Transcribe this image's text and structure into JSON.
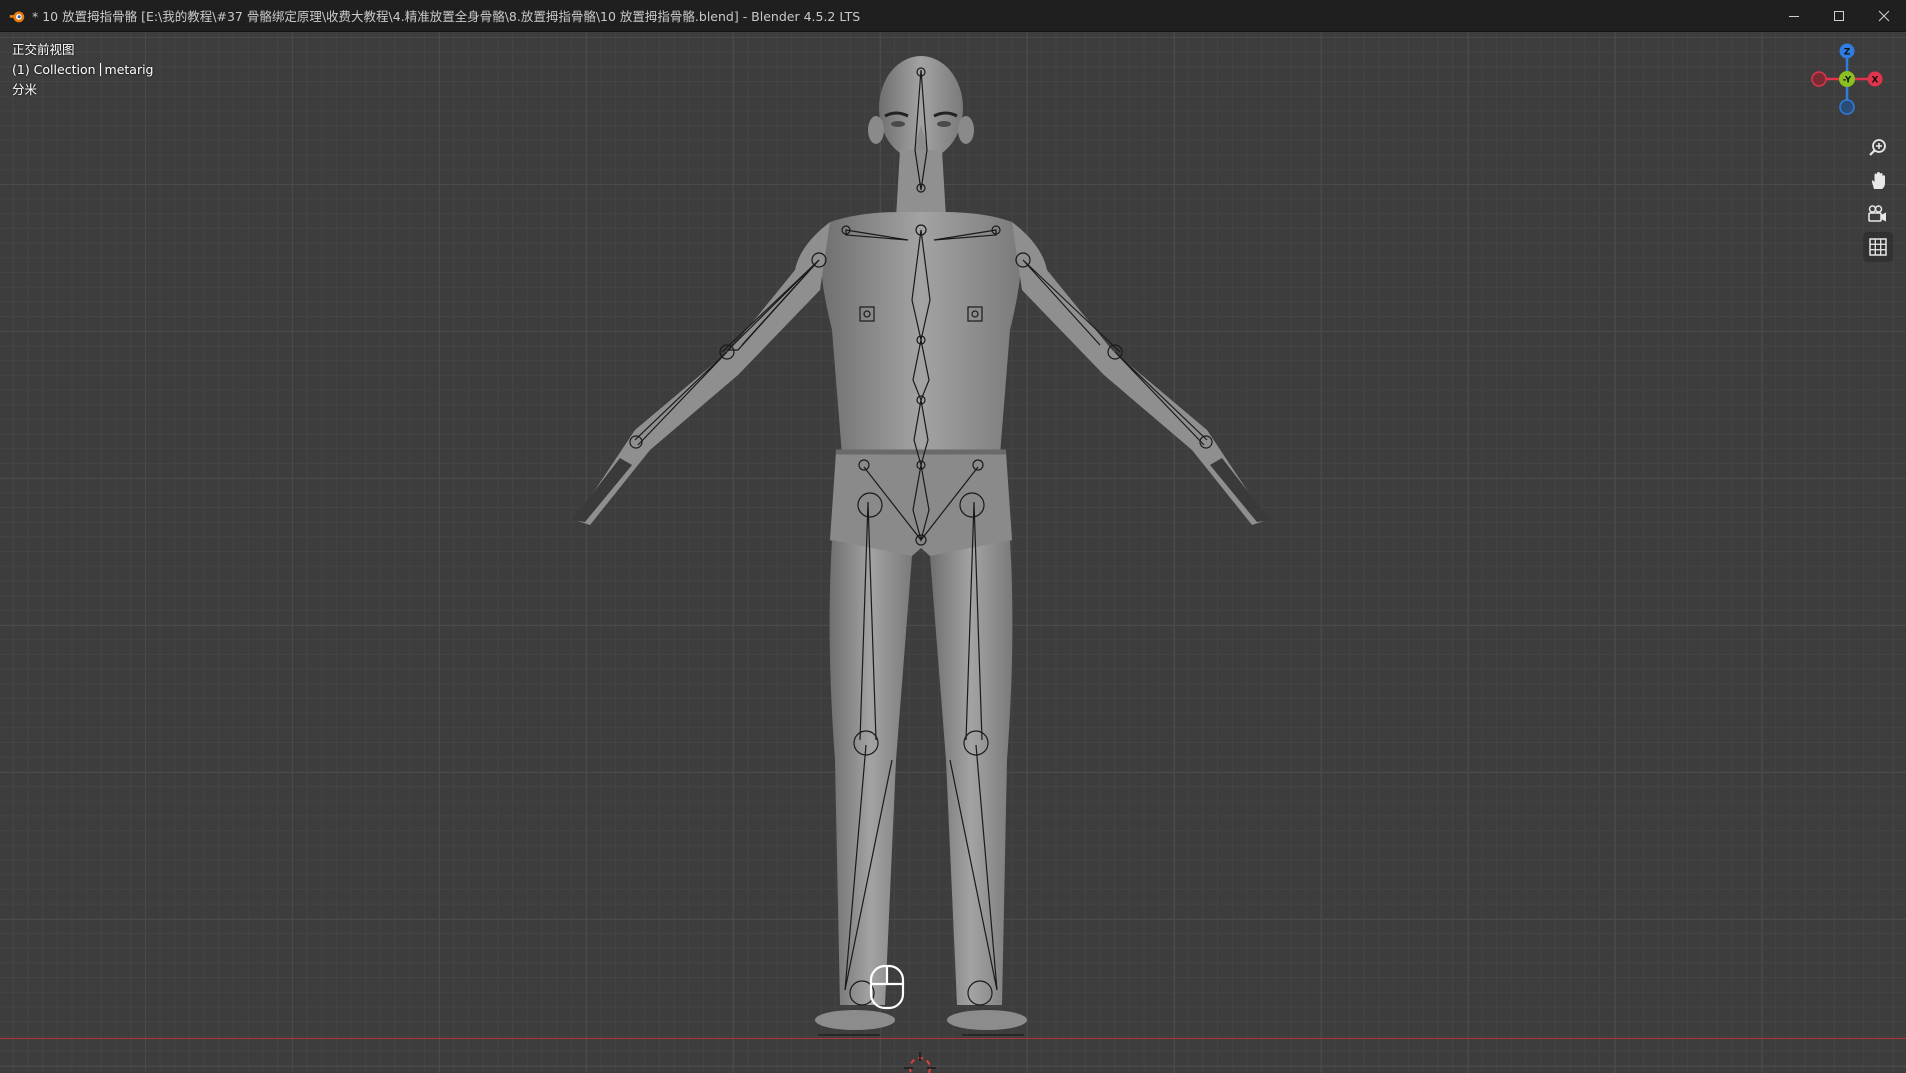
{
  "window": {
    "title": "* 10 放置拇指骨骼 [E:\\我的教程\\#37 骨骼绑定原理\\收费大教程\\4.精准放置全身骨骼\\8.放置拇指骨骼\\10 放置拇指骨骼.blend] - Blender 4.5.2 LTS",
    "controls": [
      "minimize-icon",
      "maximize-icon",
      "close-icon"
    ]
  },
  "viewport": {
    "view_name": "正交前视图",
    "collection": "(1) Collection",
    "active_object": "metarig",
    "units": "分米"
  },
  "gizmo": {
    "axes": [
      {
        "label": "Z",
        "color": "#2f7de1"
      },
      {
        "label": "-Y",
        "color": "#8ac11f"
      },
      {
        "label": "X",
        "color": "#e0344b"
      }
    ]
  },
  "nav_tools": [
    "zoom-icon",
    "pan-hand-icon",
    "camera-view-icon",
    "ortho-grid-icon"
  ],
  "colors": {
    "viewport_bg": "#3d3d3d",
    "grid_major": "#4a4a4a",
    "axis_x": "#b03434",
    "mesh": "#8a8a8a"
  }
}
